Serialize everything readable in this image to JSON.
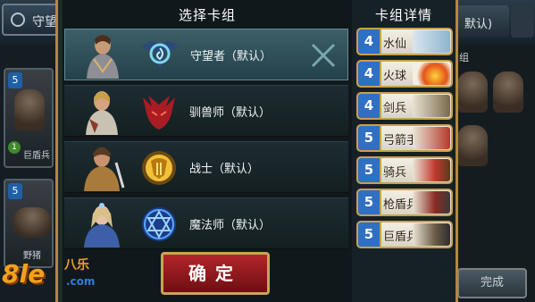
{
  "background": {
    "top_tab_label": "守望",
    "right_tab_label": "默认)",
    "right_section_label": "组",
    "left_card_1_cost": "5",
    "left_card_1_name": "巨盾兵",
    "left_card_1_level": "1",
    "left_card_2_cost": "5",
    "left_card_2_name": "野猪",
    "done_button_label": "完成"
  },
  "watermark": {
    "big": "8le",
    "small": "八乐",
    "dot": ".com"
  },
  "deck_select": {
    "title": "选择卡组",
    "decks": [
      {
        "name": "守望者（默认）",
        "emblem": "watcher-emblem-icon",
        "selected": true
      },
      {
        "name": "驯兽师（默认）",
        "emblem": "beastmaster-emblem-icon",
        "selected": false
      },
      {
        "name": "战士（默认）",
        "emblem": "warrior-emblem-icon",
        "selected": false
      },
      {
        "name": "魔法师（默认）",
        "emblem": "mage-emblem-icon",
        "selected": false
      }
    ],
    "confirm_label": "确定"
  },
  "deck_detail": {
    "title": "卡组详情",
    "cards": [
      {
        "cost": "4",
        "name": "水仙",
        "cost_color": "#2f6fc4"
      },
      {
        "cost": "4",
        "name": "火球",
        "cost_color": "#2f6fc4"
      },
      {
        "cost": "4",
        "name": "剑兵",
        "cost_color": "#2f6fc4"
      },
      {
        "cost": "5",
        "name": "弓箭手",
        "cost_color": "#2f6fc4"
      },
      {
        "cost": "5",
        "name": "骑兵",
        "cost_color": "#2f6fc4"
      },
      {
        "cost": "5",
        "name": "枪盾兵",
        "cost_color": "#2f6fc4"
      },
      {
        "cost": "5",
        "name": "巨盾兵",
        "cost_color": "#2f6fc4"
      }
    ]
  },
  "colors": {
    "frame_gold": "#c9a04a",
    "confirm_red": "#b3252a",
    "selected_row": "#3c5f68"
  }
}
